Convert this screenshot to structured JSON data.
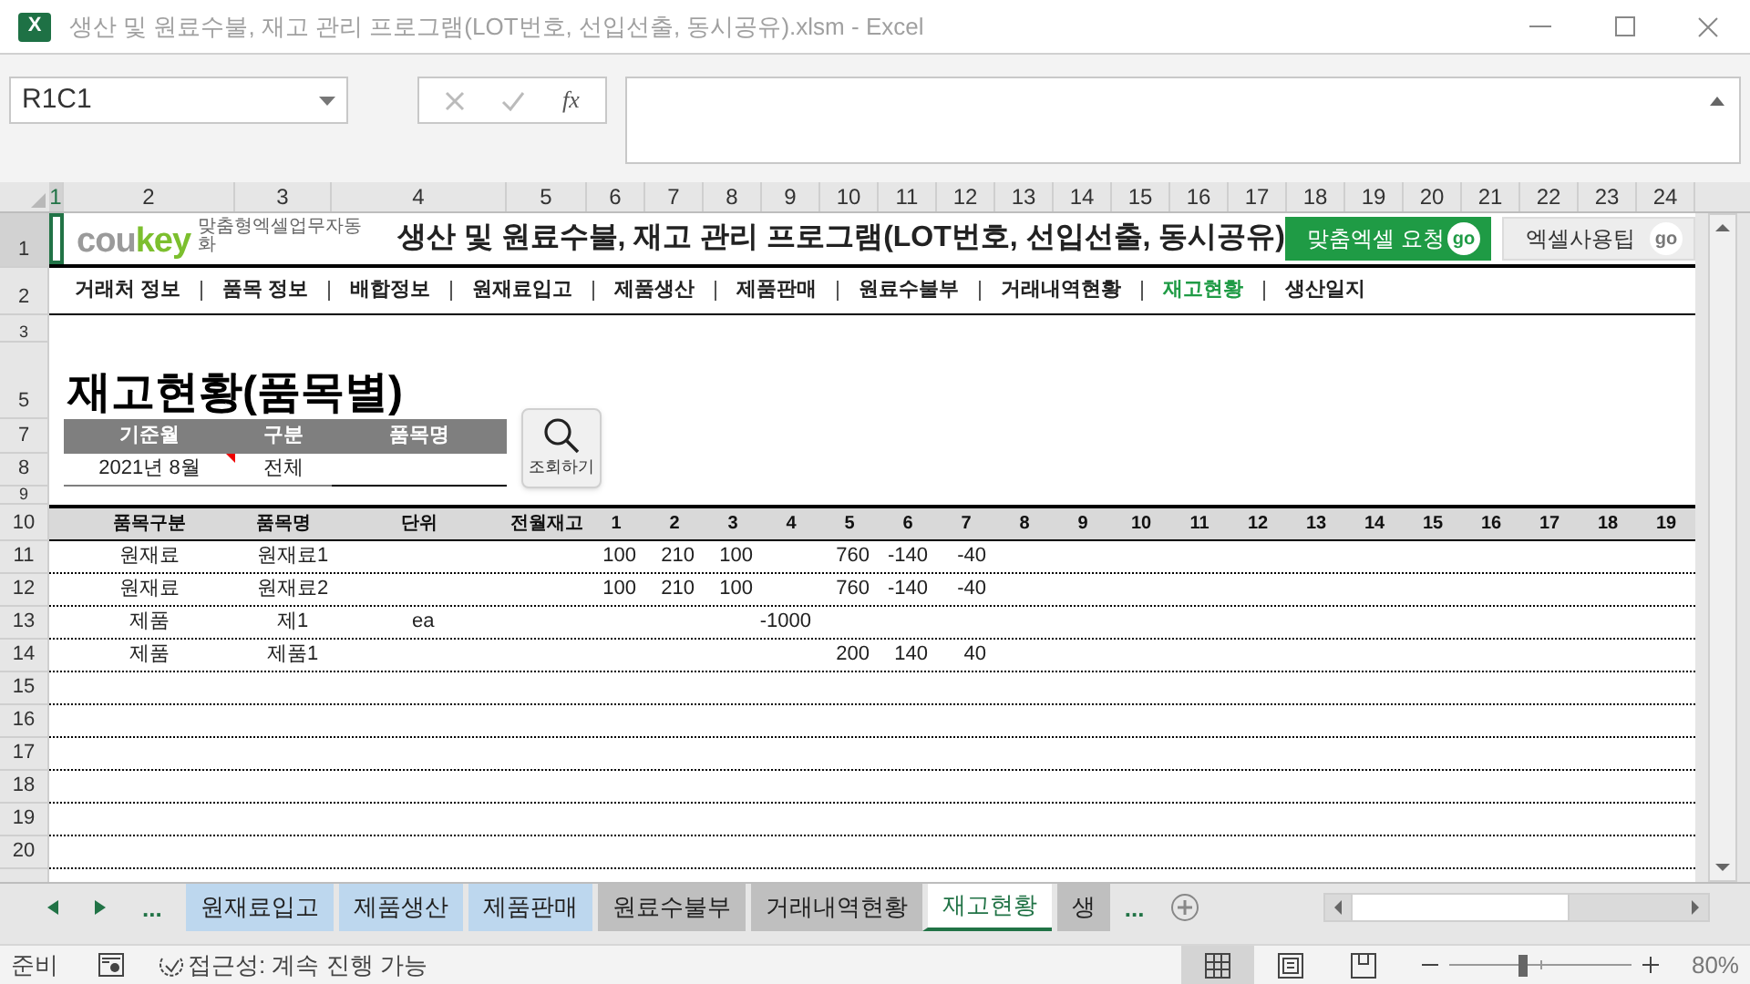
{
  "window": {
    "title": "생산 및 원료수불, 재고 관리 프로그램(LOT번호, 선입선출, 동시공유).xlsm - Excel",
    "app_icon_letter": "X"
  },
  "formula_bar": {
    "name_box": "R1C1",
    "function_label": "fx"
  },
  "column_headers": [
    "1",
    "2",
    "3",
    "4",
    "5",
    "6",
    "7",
    "8",
    "9",
    "10",
    "11",
    "12",
    "13",
    "14",
    "15",
    "16",
    "17",
    "18",
    "19",
    "20",
    "21",
    "22",
    "23",
    "24"
  ],
  "row_headers": [
    "1",
    "2",
    "3",
    "5",
    "7",
    "8",
    "9",
    "10",
    "11",
    "12",
    "13",
    "14",
    "15",
    "16",
    "17",
    "18",
    "19",
    "20"
  ],
  "header": {
    "brand_plain": "cou",
    "brand_accent": "key",
    "tagline": "맞춤형엑셀업무자동화",
    "title": "생산 및 원료수불, 재고 관리 프로그램(LOT번호, 선입선출, 동시공유)",
    "buttons": [
      {
        "label": "맞춤엑셀 요청",
        "go": "go",
        "kind": "primary"
      },
      {
        "label": "엑셀사용팁",
        "go": "go",
        "kind": "secondary"
      }
    ]
  },
  "nav": [
    {
      "label": "거래처 정보",
      "selected": false
    },
    {
      "label": "품목 정보",
      "selected": false
    },
    {
      "label": "배합정보",
      "selected": false
    },
    {
      "label": "원재료입고",
      "selected": false
    },
    {
      "label": "제품생산",
      "selected": false
    },
    {
      "label": "제품판매",
      "selected": false
    },
    {
      "label": "원료수불부",
      "selected": false
    },
    {
      "label": "거래내역현황",
      "selected": false
    },
    {
      "label": "재고현황",
      "selected": true
    },
    {
      "label": "생산일지",
      "selected": false
    }
  ],
  "page_title": "재고현황(품목별)",
  "filter": {
    "columns": [
      "기준월",
      "구분",
      "품목명"
    ],
    "month": "2021년 8월",
    "month_comment": true,
    "category": "전체"
  },
  "search_button": "조회하기",
  "table": {
    "columns": [
      "품목구분",
      "품목명",
      "단위",
      "전월재고",
      "1",
      "2",
      "3",
      "4",
      "5",
      "6",
      "7",
      "8",
      "9",
      "10",
      "11",
      "12",
      "13",
      "14",
      "15",
      "16",
      "17",
      "18",
      "19"
    ],
    "rows": [
      {
        "cells": [
          "원재료",
          "원재료1",
          null,
          null,
          "100",
          "210",
          "100",
          null,
          "760",
          "-140",
          "-40",
          null,
          null,
          null,
          null,
          null,
          null,
          null,
          null,
          null,
          null,
          null,
          null
        ]
      },
      {
        "cells": [
          "원재료",
          "원재료2",
          null,
          null,
          "100",
          "210",
          "100",
          null,
          "760",
          "-140",
          "-40",
          null,
          null,
          null,
          null,
          null,
          null,
          null,
          null,
          null,
          null,
          null,
          null
        ]
      },
      {
        "cells": [
          "제품",
          "제1",
          "ea",
          null,
          null,
          null,
          null,
          "-1000",
          null,
          null,
          null,
          null,
          null,
          null,
          null,
          null,
          null,
          null,
          null,
          null,
          null,
          null,
          null
        ]
      },
      {
        "cells": [
          "제품",
          "제품1",
          null,
          null,
          null,
          null,
          null,
          null,
          "200",
          "140",
          "40",
          null,
          null,
          null,
          null,
          null,
          null,
          null,
          null,
          null,
          null,
          null,
          null
        ]
      }
    ]
  },
  "sheet_nav": {
    "more": "..."
  },
  "sheet_tabs": [
    {
      "label": "원재료입고",
      "color": "#bdd7ee",
      "selected": false
    },
    {
      "label": "제품생산",
      "color": "#bdd7ee",
      "selected": false
    },
    {
      "label": "제품판매",
      "color": "#bdd7ee",
      "selected": false
    },
    {
      "label": "원료수불부",
      "color": "#bfbfbf",
      "selected": false
    },
    {
      "label": "거래내역현황",
      "color": "#bfbfbf",
      "selected": false
    },
    {
      "label": "재고현황",
      "color": "#ffffff",
      "selected": true
    },
    {
      "label": "생",
      "color": "#bfbfbf",
      "selected": false
    }
  ],
  "sheet_tabs_more": "...",
  "status_bar": {
    "ready": "준비",
    "accessibility": "접근성: 계속 진행 가능",
    "views": [
      {
        "kind": "normal",
        "selected": true
      },
      {
        "kind": "page_layout",
        "selected": false
      },
      {
        "kind": "page_break",
        "selected": false
      }
    ],
    "zoom": {
      "level": 0.4,
      "reading": "80%"
    }
  }
}
